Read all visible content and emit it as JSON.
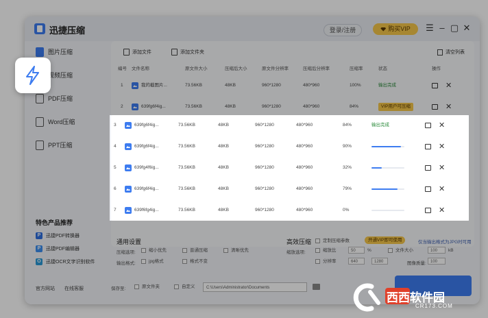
{
  "app": {
    "title": "迅捷压缩"
  },
  "header": {
    "login": "登录/注册",
    "vip": "购买VIP"
  },
  "sidebar": {
    "items": [
      {
        "label": "图片压缩"
      },
      {
        "label": "视频压缩"
      },
      {
        "label": "PDF压缩"
      },
      {
        "label": "Word压缩"
      },
      {
        "label": "PPT压缩"
      }
    ],
    "promo_title": "特色产品推荐",
    "promo": [
      {
        "label": "迅捷PDF转换器",
        "icon": "P",
        "color": "#2f6fe0"
      },
      {
        "label": "迅捷PDF编辑器",
        "icon": "P",
        "color": "#3d8ff0"
      },
      {
        "label": "迅捷OCR文字识别软件",
        "icon": "O",
        "color": "#2a9ad8"
      }
    ],
    "footer": {
      "site": "官方网站",
      "support": "在线客服"
    }
  },
  "toolbar": {
    "add_file": "添加文件",
    "add_folder": "添加文件夹",
    "clear": "清空列表"
  },
  "table": {
    "headers": [
      "编号",
      "文件名称",
      "原文件大小",
      "压缩后大小",
      "原文件分辨率",
      "压缩后分辨率",
      "压缩率",
      "状态",
      "操作"
    ],
    "rows": [
      {
        "no": "1",
        "name": "我的截图片...",
        "orig_size": "73.56KB",
        "new_size": "48KB",
        "orig_res": "960*1280",
        "new_res": "480*960",
        "rate": "100%",
        "status": "输出完成",
        "status_type": "done",
        "progress": 1.0
      },
      {
        "no": "2",
        "name": "639fg6f4ig...",
        "orig_size": "73.56KB",
        "new_size": "48KB",
        "orig_res": "960*1280",
        "new_res": "480*960",
        "rate": "84%",
        "status": "VIP用户可压缩",
        "status_type": "vip",
        "progress": 0.84
      },
      {
        "no": "3",
        "name": "639fg6f4ig...",
        "orig_size": "73.56KB",
        "new_size": "48KB",
        "orig_res": "960*1280",
        "new_res": "480*960",
        "rate": "84%",
        "status": "输出完成",
        "status_type": "done",
        "progress": 0.84
      },
      {
        "no": "4",
        "name": "639fg6f4ig...",
        "orig_size": "73.56KB",
        "new_size": "48KB",
        "orig_res": "960*1280",
        "new_res": "480*960",
        "rate": "90%",
        "status": "",
        "status_type": "progress",
        "progress": 0.9
      },
      {
        "no": "5",
        "name": "639fg4f6ig...",
        "orig_size": "73.56KB",
        "new_size": "48KB",
        "orig_res": "960*1280",
        "new_res": "480*960",
        "rate": "32%",
        "status": "",
        "status_type": "progress",
        "progress": 0.32
      },
      {
        "no": "6",
        "name": "639fg6f4ig...",
        "orig_size": "73.56KB",
        "new_size": "48KB",
        "orig_res": "960*1280",
        "new_res": "480*960",
        "rate": "79%",
        "status": "",
        "status_type": "progress",
        "progress": 0.79
      },
      {
        "no": "7",
        "name": "639f6fg4ig...",
        "orig_size": "73.56KB",
        "new_size": "48KB",
        "orig_res": "960*1280",
        "new_res": "480*960",
        "rate": "0%",
        "status": "",
        "status_type": "progress",
        "progress": 0.0
      }
    ]
  },
  "settings": {
    "general_title": "通用设置",
    "compress_option_label": "压缩选项:",
    "options": [
      "缩小优先",
      "普通压缩",
      "清晰优先"
    ],
    "output_format_label": "输出格式:",
    "formats": [
      "jpg格式",
      "格式不变"
    ],
    "efficient_title": "高效压缩",
    "custom_compress": "定制压缩参数",
    "open_vip": "开通VIP即可使用",
    "vip_note": "仅当输出格式为JPG时可用",
    "scale_label": "缩放选项:",
    "scale_ratio": "缩放比",
    "scale_value": "50",
    "pct": "%",
    "file_size_label": "文件大小",
    "file_size_value": "100",
    "kb": "kB",
    "resolution_label": "分辨率",
    "res_w": "640",
    "res_h": "1280",
    "quality_label": "图像质量:",
    "quality_value": "100"
  },
  "bottom": {
    "save_to": "保存至:",
    "orig_folder": "原文件夹",
    "custom": "自定义",
    "path": "C:\\Users\\Administrator\\Documents"
  },
  "watermark": {
    "text": "西西软件园",
    "url": "CR173.COM"
  }
}
